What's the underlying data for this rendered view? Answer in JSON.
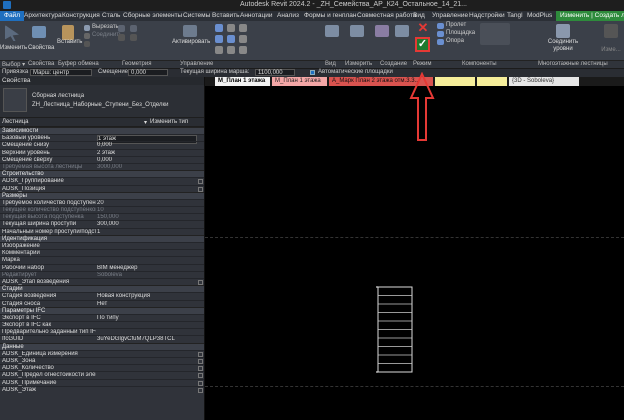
{
  "window": {
    "title": "Autodesk Revit 2024.2 - _ZH_Семейства_АР_К24_Остальное_14_21..."
  },
  "ribbon_tabs": [
    "Файл",
    "Архитектура",
    "Конструкция",
    "Сталь",
    "Сборные элементы",
    "Системы",
    "Вставить",
    "Аннотации",
    "Анализ",
    "Формы и генплан",
    "Совместная работа",
    "Вид",
    "Управление",
    "Надстройки",
    "Tangl",
    "ModPlus",
    "Изменить | Создать лестниц"
  ],
  "ribbon": {
    "modify_label": "Изменить",
    "properties_label": "Свойства",
    "paste_label": "Вставить",
    "cut_label": "Вырезать",
    "join_label": "Соединить",
    "activate_label": "Активировать",
    "view_label": "Вид",
    "measure_label": "Измерить",
    "create_label": "Создание",
    "run_label": "Пролет",
    "landing_label": "Площадка",
    "support_label": "Опора",
    "connect_levels_label": "Соединить уровни",
    "edit_label": "Изме..."
  },
  "panel_titles": {
    "select": "Выбор ▾",
    "properties": "Свойства",
    "clipboard": "Буфер обмена",
    "geometry": "Геометрия",
    "manage": "Управление",
    "view": "Вид",
    "measure": "Измерить",
    "create": "Создание",
    "mode": "Режим",
    "components": "Компоненты",
    "multistory": "Многоэтажные лестницы"
  },
  "options_bar": {
    "anchor_label": "Привязка",
    "anchor_value": "Марш: центр",
    "offset_label": "Смещение:",
    "offset_value": "0,000",
    "width_label": "Текущая ширина марша:",
    "width_value": "1100,000",
    "auto_landing_label": "Автоматические площадки"
  },
  "view_tabs": [
    {
      "label": "М_План 1 этажа",
      "active": true
    },
    {
      "label": "М_План 1 этажа",
      "active": false
    },
    {
      "label": "А_Марк План 2 этажа отм.3.3...",
      "active": false
    },
    {
      "label": "",
      "active": false
    },
    {
      "label": "",
      "active": false
    },
    {
      "label": "{3D - Soboleva}",
      "active": false
    }
  ],
  "properties": {
    "header": "Свойства",
    "family": "Сборная лестница",
    "type": "ZH_Лестница_Наборные_Ступени_Без_Отделки",
    "filter": "Лестница",
    "edit_type": "Изменить тип",
    "sections": [
      {
        "title": "Зависимости",
        "rows": [
          {
            "k": "Базовый уровень",
            "v": "1 этаж",
            "edit": true
          },
          {
            "k": "Смещение снизу",
            "v": "0,000"
          },
          {
            "k": "Верхний уровень",
            "v": "2 этаж"
          },
          {
            "k": "Смещение сверху",
            "v": "0,000"
          },
          {
            "k": "Требуемая высота лестницы",
            "v": "3000,000",
            "dim": true
          }
        ]
      },
      {
        "title": "Строительство",
        "rows": [
          {
            "k": "ADSK_Группирование",
            "v": "",
            "sq": true
          },
          {
            "k": "ADSK_Позиция",
            "v": "",
            "sq": true
          }
        ]
      },
      {
        "title": "Размеры",
        "rows": [
          {
            "k": "Требуемое количество подступенков",
            "v": "20"
          },
          {
            "k": "Текущее количество подступенков",
            "v": "10",
            "dim": true
          },
          {
            "k": "Текущая высота подступенка",
            "v": "150,000",
            "dim": true
          },
          {
            "k": "Текущая ширина проступи",
            "v": "300,000"
          },
          {
            "k": "Начальный номер проступи/подступ...",
            "v": "1"
          }
        ]
      },
      {
        "title": "Идентификация",
        "rows": [
          {
            "k": "Изображение",
            "v": ""
          },
          {
            "k": "Комментарии",
            "v": ""
          },
          {
            "k": "Марка",
            "v": ""
          },
          {
            "k": "Рабочий набор",
            "v": "BIM менеджер"
          },
          {
            "k": "Редактирует",
            "v": "Soboleva",
            "dim": true
          },
          {
            "k": "ADSK_Этап возведения",
            "v": "",
            "sq": true
          }
        ]
      },
      {
        "title": "Стадии",
        "rows": [
          {
            "k": "Стадия возведения",
            "v": "Новая конструкция"
          },
          {
            "k": "Стадия сноса",
            "v": "Нет"
          }
        ]
      },
      {
        "title": "Параметры IFC",
        "rows": [
          {
            "k": "Экспорт в IFC",
            "v": "По типу"
          },
          {
            "k": "Экспорт в IFC как",
            "v": ""
          },
          {
            "k": "Предварительно заданный тип IFC",
            "v": ""
          },
          {
            "k": "IfcGUID",
            "v": "3uYeDGlgvCfuM7QLP38TCL"
          }
        ]
      },
      {
        "title": "Данные",
        "rows": [
          {
            "k": "ADSK_Единица измерения",
            "v": "",
            "sq": true
          },
          {
            "k": "ADSK_Зона",
            "v": "",
            "sq": true
          },
          {
            "k": "ADSK_Количество",
            "v": "",
            "sq": true
          },
          {
            "k": "ADSK_Предел огнестойкости элемент...",
            "v": "",
            "sq": true
          },
          {
            "k": "ADSK_Примечание",
            "v": "",
            "sq": true
          },
          {
            "k": "ADSK_Этаж",
            "v": "",
            "sq": true
          }
        ]
      }
    ]
  }
}
